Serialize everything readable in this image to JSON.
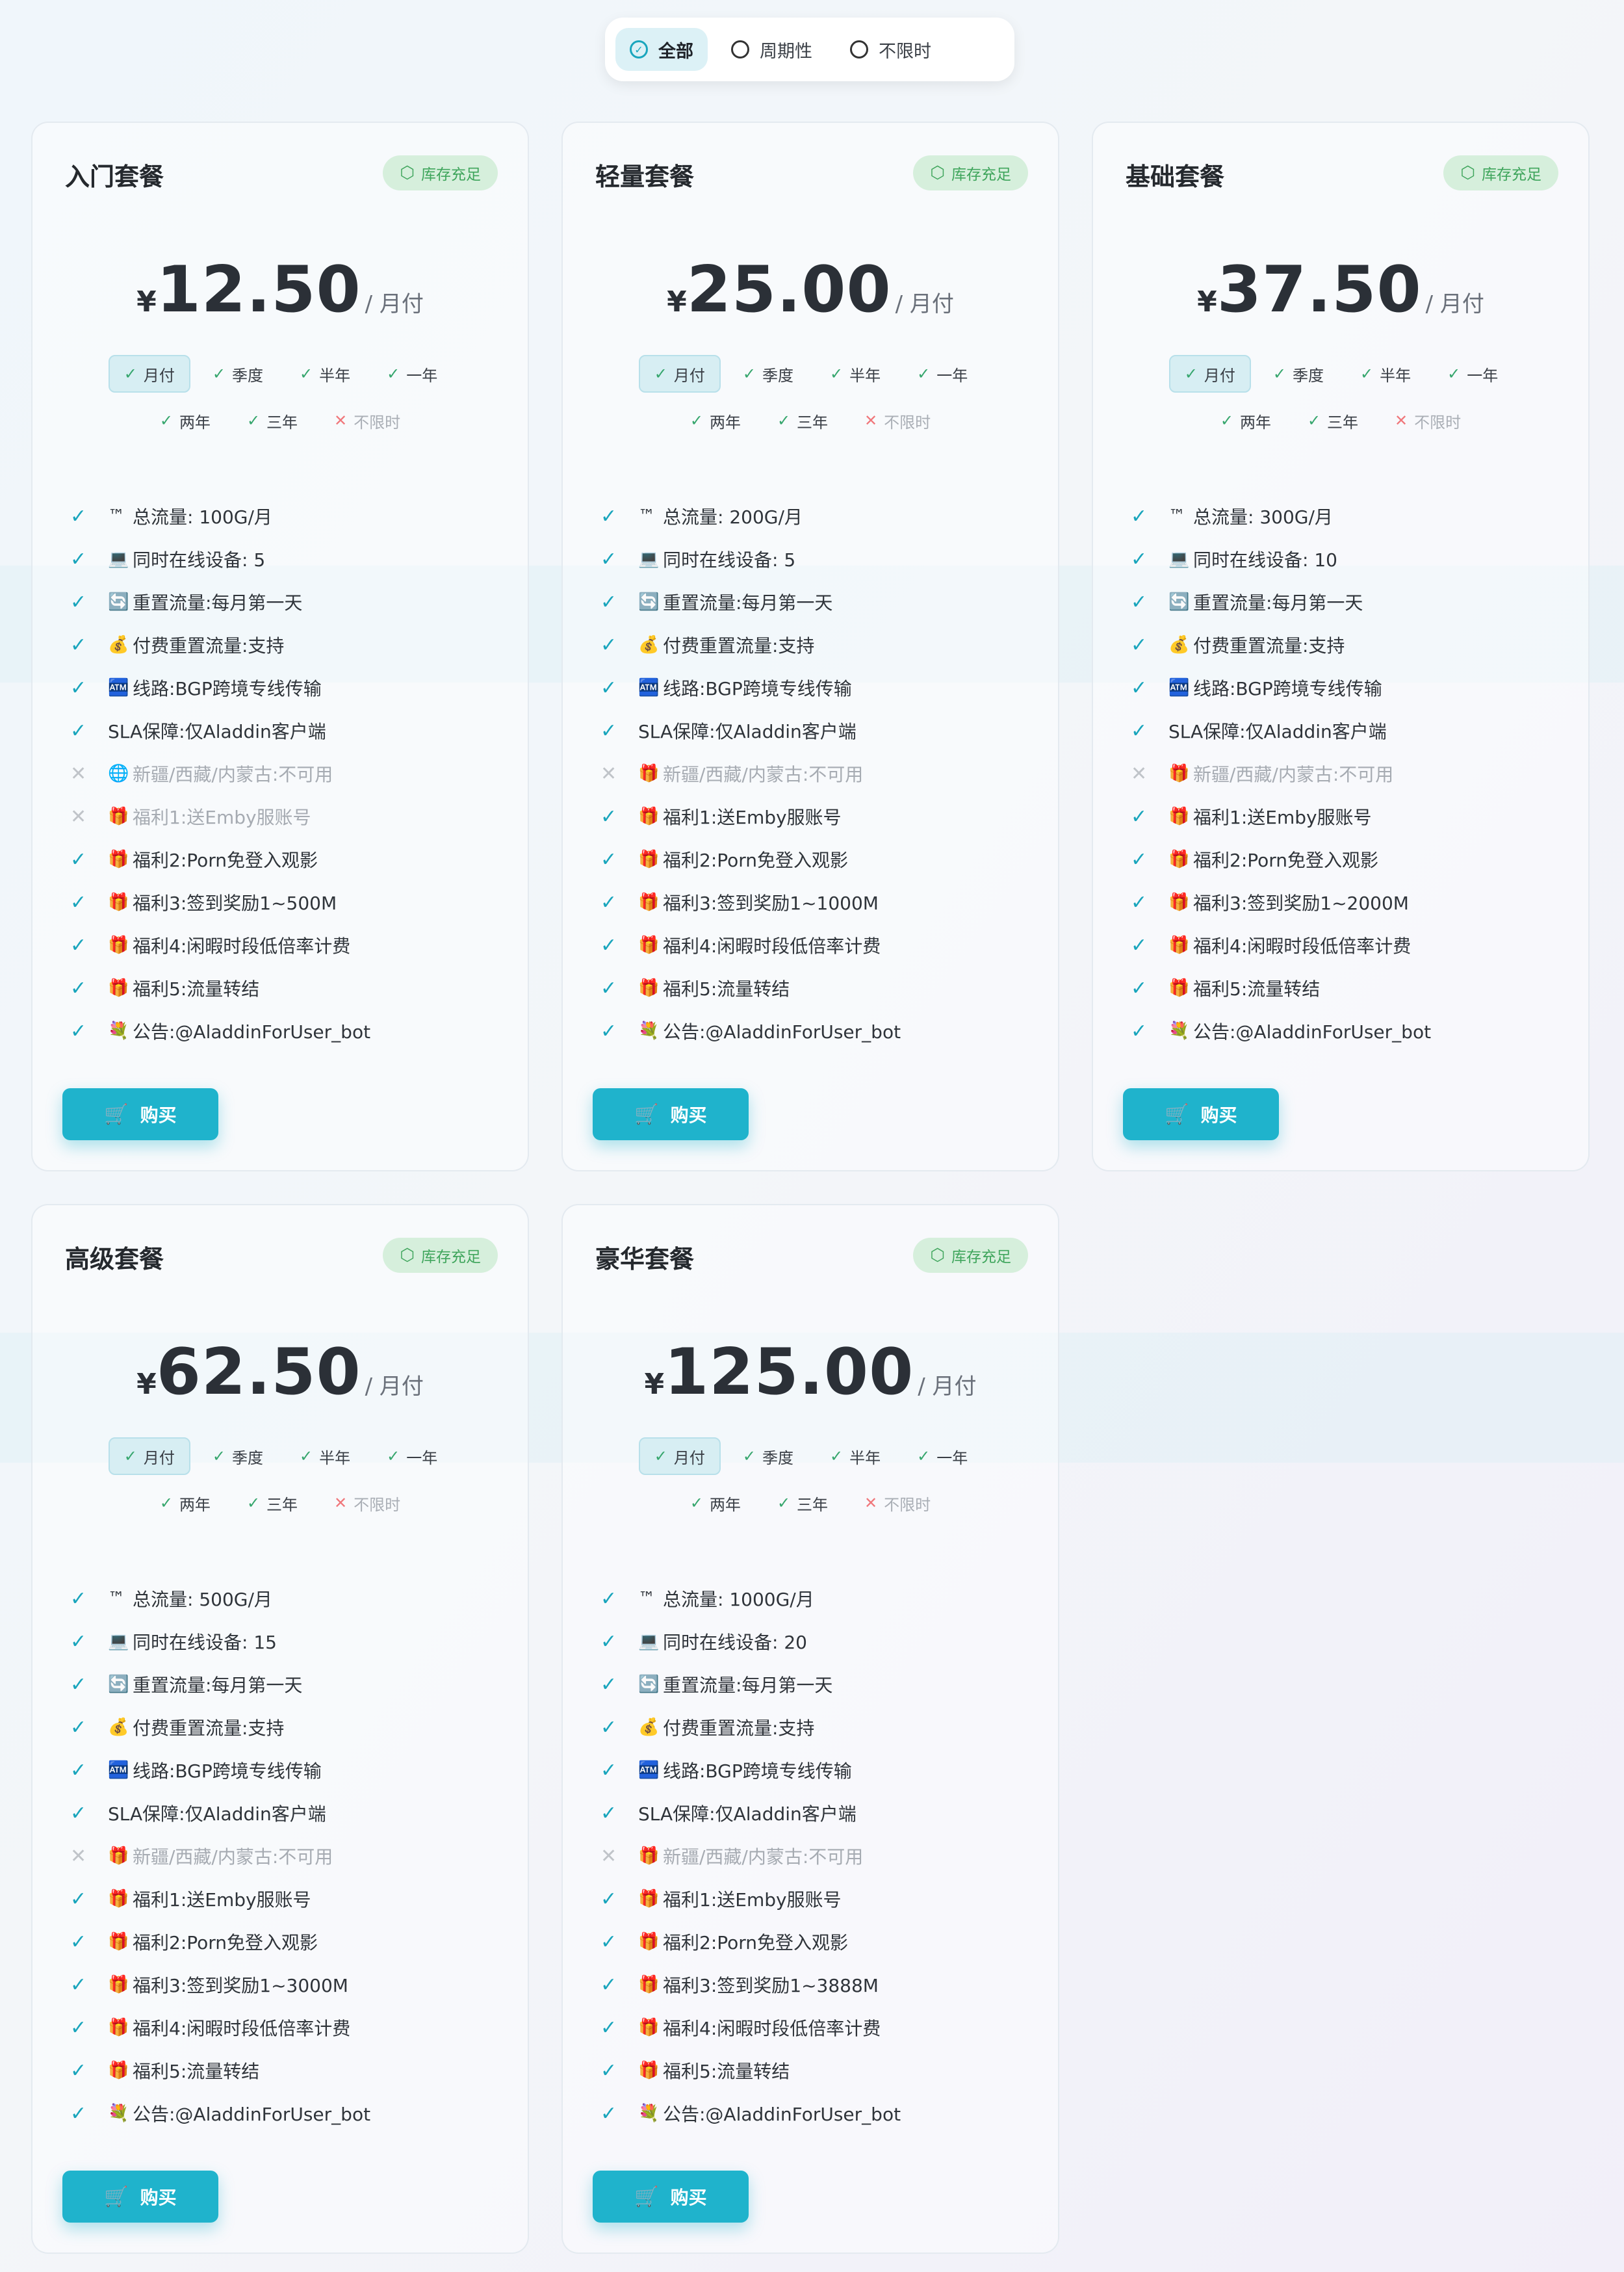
{
  "filter": {
    "options": [
      {
        "label": "全部",
        "active": true
      },
      {
        "label": "周期性",
        "active": false
      },
      {
        "label": "不限时",
        "active": false
      }
    ]
  },
  "currency_symbol": "¥",
  "buy_label": "购买",
  "colors": {
    "accent": "#1fb3cc",
    "stock_green": "#3fa55c",
    "disabled": "#a6abb2"
  },
  "plans": [
    {
      "name": "入门套餐",
      "stock": "库存充足",
      "price": "12.50",
      "period": "/ 月付",
      "periods_row1": [
        {
          "label": "月付",
          "on": true,
          "sel": true
        },
        {
          "label": "季度",
          "on": true
        },
        {
          "label": "半年",
          "on": true
        },
        {
          "label": "一年",
          "on": true
        }
      ],
      "periods_row2": [
        {
          "label": "两年",
          "on": true
        },
        {
          "label": "三年",
          "on": true
        },
        {
          "label": "不限时",
          "on": false
        }
      ],
      "features": [
        {
          "on": true,
          "icon": "™",
          "text": "总流量: 100G/月"
        },
        {
          "on": true,
          "icon": "💻",
          "text": "同时在线设备: 5"
        },
        {
          "on": true,
          "icon": "🔄",
          "text": "重置流量:每月第一天"
        },
        {
          "on": true,
          "icon": "💰",
          "text": "付费重置流量:支持"
        },
        {
          "on": true,
          "icon": "🏧",
          "text": "线路:BGP跨境专线传输"
        },
        {
          "on": true,
          "icon": "",
          "text": "SLA保障:仅Aladdin客户端"
        },
        {
          "on": false,
          "icon": "🌐",
          "text": "新疆/西藏/内蒙古:不可用"
        },
        {
          "on": false,
          "icon": "🎁",
          "text": "福利1:送Emby服账号"
        },
        {
          "on": true,
          "icon": "🎁",
          "text": "福利2:Porn免登入观影"
        },
        {
          "on": true,
          "icon": "🎁",
          "text": "福利3:签到奖励1~500M"
        },
        {
          "on": true,
          "icon": "🎁",
          "text": "福利4:闲暇时段低倍率计费"
        },
        {
          "on": true,
          "icon": "🎁",
          "text": "福利5:流量转结"
        },
        {
          "on": true,
          "icon": "💐",
          "text": "公告:@AladdinForUser_bot"
        }
      ]
    },
    {
      "name": "轻量套餐",
      "stock": "库存充足",
      "price": "25.00",
      "period": "/ 月付",
      "periods_row1": [
        {
          "label": "月付",
          "on": true,
          "sel": true
        },
        {
          "label": "季度",
          "on": true
        },
        {
          "label": "半年",
          "on": true
        },
        {
          "label": "一年",
          "on": true
        }
      ],
      "periods_row2": [
        {
          "label": "两年",
          "on": true
        },
        {
          "label": "三年",
          "on": true
        },
        {
          "label": "不限时",
          "on": false
        }
      ],
      "features": [
        {
          "on": true,
          "icon": "™",
          "text": "总流量: 200G/月"
        },
        {
          "on": true,
          "icon": "💻",
          "text": "同时在线设备: 5"
        },
        {
          "on": true,
          "icon": "🔄",
          "text": "重置流量:每月第一天"
        },
        {
          "on": true,
          "icon": "💰",
          "text": "付费重置流量:支持"
        },
        {
          "on": true,
          "icon": "🏧",
          "text": "线路:BGP跨境专线传输"
        },
        {
          "on": true,
          "icon": "",
          "text": "SLA保障:仅Aladdin客户端"
        },
        {
          "on": false,
          "icon": "🎁",
          "text": "新疆/西藏/内蒙古:不可用"
        },
        {
          "on": true,
          "icon": "🎁",
          "text": "福利1:送Emby服账号"
        },
        {
          "on": true,
          "icon": "🎁",
          "text": "福利2:Porn免登入观影"
        },
        {
          "on": true,
          "icon": "🎁",
          "text": "福利3:签到奖励1~1000M"
        },
        {
          "on": true,
          "icon": "🎁",
          "text": "福利4:闲暇时段低倍率计费"
        },
        {
          "on": true,
          "icon": "🎁",
          "text": "福利5:流量转结"
        },
        {
          "on": true,
          "icon": "💐",
          "text": "公告:@AladdinForUser_bot"
        }
      ]
    },
    {
      "name": "基础套餐",
      "stock": "库存充足",
      "price": "37.50",
      "period": "/ 月付",
      "periods_row1": [
        {
          "label": "月付",
          "on": true,
          "sel": true
        },
        {
          "label": "季度",
          "on": true
        },
        {
          "label": "半年",
          "on": true
        },
        {
          "label": "一年",
          "on": true
        }
      ],
      "periods_row2": [
        {
          "label": "两年",
          "on": true
        },
        {
          "label": "三年",
          "on": true
        },
        {
          "label": "不限时",
          "on": false
        }
      ],
      "features": [
        {
          "on": true,
          "icon": "™",
          "text": "总流量: 300G/月"
        },
        {
          "on": true,
          "icon": "💻",
          "text": "同时在线设备: 10"
        },
        {
          "on": true,
          "icon": "🔄",
          "text": "重置流量:每月第一天"
        },
        {
          "on": true,
          "icon": "💰",
          "text": "付费重置流量:支持"
        },
        {
          "on": true,
          "icon": "🏧",
          "text": "线路:BGP跨境专线传输"
        },
        {
          "on": true,
          "icon": "",
          "text": "SLA保障:仅Aladdin客户端"
        },
        {
          "on": false,
          "icon": "🎁",
          "text": "新疆/西藏/内蒙古:不可用"
        },
        {
          "on": true,
          "icon": "🎁",
          "text": "福利1:送Emby服账号"
        },
        {
          "on": true,
          "icon": "🎁",
          "text": "福利2:Porn免登入观影"
        },
        {
          "on": true,
          "icon": "🎁",
          "text": "福利3:签到奖励1~2000M"
        },
        {
          "on": true,
          "icon": "🎁",
          "text": "福利4:闲暇时段低倍率计费"
        },
        {
          "on": true,
          "icon": "🎁",
          "text": "福利5:流量转结"
        },
        {
          "on": true,
          "icon": "💐",
          "text": "公告:@AladdinForUser_bot"
        }
      ]
    },
    {
      "name": "高级套餐",
      "stock": "库存充足",
      "price": "62.50",
      "period": "/ 月付",
      "periods_row1": [
        {
          "label": "月付",
          "on": true,
          "sel": true
        },
        {
          "label": "季度",
          "on": true
        },
        {
          "label": "半年",
          "on": true
        },
        {
          "label": "一年",
          "on": true
        }
      ],
      "periods_row2": [
        {
          "label": "两年",
          "on": true
        },
        {
          "label": "三年",
          "on": true
        },
        {
          "label": "不限时",
          "on": false
        }
      ],
      "features": [
        {
          "on": true,
          "icon": "™",
          "text": "总流量: 500G/月"
        },
        {
          "on": true,
          "icon": "💻",
          "text": "同时在线设备: 15"
        },
        {
          "on": true,
          "icon": "🔄",
          "text": "重置流量:每月第一天"
        },
        {
          "on": true,
          "icon": "💰",
          "text": "付费重置流量:支持"
        },
        {
          "on": true,
          "icon": "🏧",
          "text": "线路:BGP跨境专线传输"
        },
        {
          "on": true,
          "icon": "",
          "text": "SLA保障:仅Aladdin客户端"
        },
        {
          "on": false,
          "icon": "🎁",
          "text": "新疆/西藏/内蒙古:不可用"
        },
        {
          "on": true,
          "icon": "🎁",
          "text": "福利1:送Emby服账号"
        },
        {
          "on": true,
          "icon": "🎁",
          "text": "福利2:Porn免登入观影"
        },
        {
          "on": true,
          "icon": "🎁",
          "text": "福利3:签到奖励1~3000M"
        },
        {
          "on": true,
          "icon": "🎁",
          "text": "福利4:闲暇时段低倍率计费"
        },
        {
          "on": true,
          "icon": "🎁",
          "text": "福利5:流量转结"
        },
        {
          "on": true,
          "icon": "💐",
          "text": "公告:@AladdinForUser_bot"
        }
      ]
    },
    {
      "name": "豪华套餐",
      "stock": "库存充足",
      "price": "125.00",
      "period": "/ 月付",
      "periods_row1": [
        {
          "label": "月付",
          "on": true,
          "sel": true
        },
        {
          "label": "季度",
          "on": true
        },
        {
          "label": "半年",
          "on": true
        },
        {
          "label": "一年",
          "on": true
        }
      ],
      "periods_row2": [
        {
          "label": "两年",
          "on": true
        },
        {
          "label": "三年",
          "on": true
        },
        {
          "label": "不限时",
          "on": false
        }
      ],
      "features": [
        {
          "on": true,
          "icon": "™",
          "text": "总流量: 1000G/月"
        },
        {
          "on": true,
          "icon": "💻",
          "text": "同时在线设备: 20"
        },
        {
          "on": true,
          "icon": "🔄",
          "text": "重置流量:每月第一天"
        },
        {
          "on": true,
          "icon": "💰",
          "text": "付费重置流量:支持"
        },
        {
          "on": true,
          "icon": "🏧",
          "text": "线路:BGP跨境专线传输"
        },
        {
          "on": true,
          "icon": "",
          "text": "SLA保障:仅Aladdin客户端"
        },
        {
          "on": false,
          "icon": "🎁",
          "text": "新疆/西藏/内蒙古:不可用"
        },
        {
          "on": true,
          "icon": "🎁",
          "text": "福利1:送Emby服账号"
        },
        {
          "on": true,
          "icon": "🎁",
          "text": "福利2:Porn免登入观影"
        },
        {
          "on": true,
          "icon": "🎁",
          "text": "福利3:签到奖励1~3888M"
        },
        {
          "on": true,
          "icon": "🎁",
          "text": "福利4:闲暇时段低倍率计费"
        },
        {
          "on": true,
          "icon": "🎁",
          "text": "福利5:流量转结"
        },
        {
          "on": true,
          "icon": "💐",
          "text": "公告:@AladdinForUser_bot"
        }
      ]
    }
  ]
}
